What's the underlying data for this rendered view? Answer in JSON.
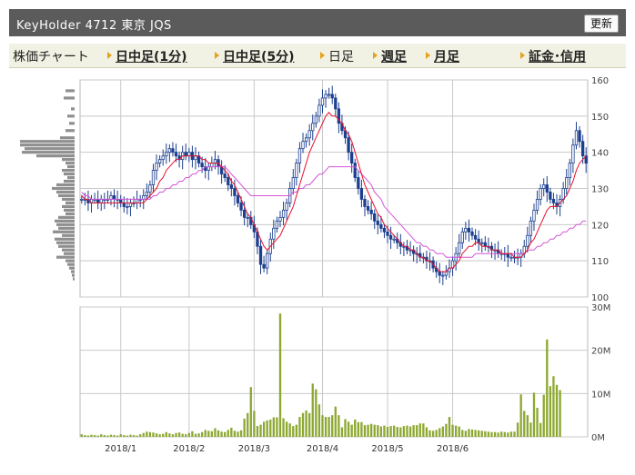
{
  "header": {
    "title": "KeyHolder 4712 東京 JQS",
    "refresh_label": "更新"
  },
  "tabs": [
    {
      "label": "株価チャート",
      "link": false,
      "arrow": false
    },
    {
      "label": "日中足(1分)",
      "link": true,
      "arrow": true
    },
    {
      "label": "日中足(5分)",
      "link": true,
      "arrow": true
    },
    {
      "label": "日足",
      "link": false,
      "arrow": true
    },
    {
      "label": "週足",
      "link": true,
      "arrow": true
    },
    {
      "label": "月足",
      "link": true,
      "arrow": true
    },
    {
      "label": "証金･信用",
      "link": true,
      "arrow": true
    }
  ],
  "colors": {
    "candle": "#1c3f8f",
    "ma_short": "#e8102a",
    "ma_long": "#d455d8",
    "volume": "#8da832",
    "grid": "#c8c8c8",
    "profile": "#8f8f8f"
  },
  "chart_data": [
    {
      "type": "candlestick",
      "title": "",
      "y_ticks": [
        100,
        110,
        120,
        130,
        140,
        150,
        160
      ],
      "ylim": [
        100,
        160
      ],
      "x_labels": [
        "2018/1",
        "2018/2",
        "2018/3",
        "2018/4",
        "2018/5",
        "2018/6"
      ],
      "x_label_day_index": [
        12,
        33,
        53,
        74,
        94,
        114
      ],
      "close_series": [
        127,
        127,
        126,
        127,
        127,
        126,
        127,
        127,
        127,
        128,
        127,
        127,
        126,
        125,
        125,
        126,
        126,
        127,
        127,
        128,
        129,
        131,
        135,
        137,
        138,
        139,
        140,
        141,
        140,
        139,
        138,
        140,
        139,
        140,
        138,
        139,
        137,
        136,
        135,
        136,
        137,
        138,
        136,
        134,
        133,
        131,
        130,
        128,
        126,
        124,
        122,
        122,
        120,
        118,
        114,
        109,
        108,
        112,
        116,
        119,
        121,
        122,
        124,
        126,
        130,
        133,
        137,
        141,
        143,
        144,
        146,
        148,
        150,
        153,
        155,
        156,
        156,
        155,
        152,
        148,
        146,
        144,
        140,
        137,
        133,
        130,
        127,
        125,
        124,
        123,
        121,
        120,
        119,
        118,
        117,
        116,
        116,
        115,
        114,
        114,
        113,
        113,
        112,
        112,
        111,
        111,
        110,
        110,
        108,
        107,
        106,
        106,
        107,
        108,
        110,
        112,
        115,
        118,
        119,
        118,
        117,
        116,
        115,
        115,
        114,
        114,
        113,
        113,
        112,
        112,
        112,
        111,
        111,
        111,
        111,
        112,
        114,
        117,
        121,
        124,
        127,
        130,
        131,
        129,
        127,
        126,
        125,
        127,
        130,
        133,
        137,
        142,
        146,
        143,
        139,
        137
      ],
      "ma_short": [
        128,
        127,
        127,
        126,
        126,
        126,
        126,
        126,
        126,
        126,
        126,
        126,
        126,
        126,
        126,
        126,
        126,
        126,
        126,
        126,
        127,
        128,
        129,
        130,
        132,
        133,
        135,
        136,
        137,
        138,
        138,
        139,
        139,
        139,
        139,
        139,
        139,
        138,
        138,
        137,
        137,
        137,
        137,
        136,
        135,
        134,
        132,
        131,
        129,
        127,
        125,
        123,
        122,
        120,
        118,
        116,
        114,
        113,
        114,
        115,
        116,
        117,
        119,
        121,
        123,
        125,
        128,
        131,
        134,
        137,
        140,
        142,
        144,
        146,
        148,
        150,
        151,
        150,
        150,
        149,
        148,
        146,
        145,
        143,
        140,
        137,
        134,
        131,
        129,
        127,
        125,
        123,
        122,
        120,
        119,
        118,
        117,
        116,
        115,
        114,
        114,
        113,
        113,
        112,
        111,
        111,
        110,
        110,
        109,
        108,
        107,
        107,
        107,
        108,
        108,
        109,
        110,
        112,
        113,
        114,
        114,
        115,
        115,
        114,
        114,
        114,
        113,
        113,
        113,
        112,
        112,
        112,
        112,
        111,
        111,
        111,
        112,
        113,
        115,
        116,
        118,
        120,
        122,
        124,
        125,
        125,
        125,
        126,
        127,
        128,
        130,
        132,
        135,
        137,
        138,
        139
      ],
      "ma_long": [
        129,
        128,
        128,
        127,
        127,
        127,
        127,
        127,
        127,
        127,
        127,
        127,
        127,
        127,
        127,
        127,
        127,
        127,
        127,
        127,
        127,
        127,
        128,
        128,
        129,
        129,
        130,
        130,
        131,
        131,
        132,
        132,
        133,
        133,
        134,
        134,
        135,
        135,
        136,
        136,
        136,
        136,
        136,
        136,
        136,
        135,
        134,
        133,
        132,
        131,
        130,
        129,
        128,
        128,
        128,
        128,
        128,
        128,
        128,
        128,
        128,
        128,
        128,
        128,
        128,
        129,
        129,
        130,
        130,
        131,
        131,
        132,
        133,
        134,
        134,
        135,
        136,
        136,
        136,
        136,
        136,
        136,
        136,
        136,
        136,
        135,
        134,
        133,
        132,
        131,
        129,
        128,
        127,
        125,
        124,
        123,
        122,
        121,
        120,
        119,
        118,
        117,
        116,
        115,
        115,
        114,
        114,
        113,
        113,
        112,
        112,
        112,
        111,
        111,
        111,
        111,
        111,
        111,
        111,
        111,
        111,
        112,
        112,
        112,
        112,
        112,
        112,
        112,
        112,
        112,
        112,
        112,
        112,
        112,
        112,
        112,
        112,
        113,
        113,
        113,
        114,
        114,
        115,
        115,
        116,
        116,
        117,
        117,
        118,
        118,
        119,
        119,
        120,
        120,
        121,
        121
      ],
      "price_profile_levels": [
        157,
        155,
        152,
        150,
        148,
        146,
        144,
        143,
        142,
        141,
        140,
        139,
        138,
        137,
        136,
        135,
        134,
        133,
        132,
        131,
        130,
        129,
        128,
        127,
        126,
        125,
        124,
        123,
        122,
        121,
        120,
        119,
        118,
        117,
        116,
        115,
        114,
        113,
        112,
        111,
        110,
        109,
        108,
        107,
        106,
        105
      ],
      "price_profile_widths": [
        10,
        12,
        4,
        8,
        6,
        10,
        16,
        60,
        60,
        55,
        58,
        42,
        14,
        10,
        8,
        14,
        12,
        8,
        12,
        20,
        25,
        20,
        18,
        14,
        10,
        14,
        12,
        10,
        18,
        22,
        20,
        18,
        24,
        14,
        22,
        20,
        18,
        14,
        12,
        20,
        10,
        8,
        6,
        4,
        3,
        2
      ]
    },
    {
      "type": "bar",
      "title": "",
      "y_ticks": [
        "0M",
        "10M",
        "20M",
        "30M"
      ],
      "ylim": [
        0,
        30
      ],
      "unit": "M",
      "values": [
        0.6,
        0.4,
        0.3,
        0.5,
        0.4,
        0.3,
        0.6,
        0.4,
        0.3,
        0.5,
        0.4,
        0.3,
        0.6,
        0.4,
        0.3,
        0.5,
        0.4,
        0.3,
        0.6,
        0.9,
        1.2,
        1.1,
        1.0,
        0.8,
        0.6,
        0.7,
        1.1,
        0.8,
        0.6,
        0.9,
        1.0,
        0.7,
        0.6,
        0.9,
        1.3,
        0.7,
        0.8,
        1.1,
        1.6,
        1.4,
        1.3,
        2.0,
        1.5,
        1.2,
        1.1,
        1.6,
        2.1,
        1.4,
        1.2,
        1.5,
        4.2,
        5.5,
        11.5,
        6.0,
        2.5,
        2.8,
        3.5,
        3.8,
        4.0,
        4.5,
        4.5,
        28.5,
        4.3,
        3.5,
        3.1,
        2.5,
        2.8,
        4.6,
        5.5,
        6.1,
        5.5,
        12.3,
        11.0,
        7.5,
        5.0,
        4.6,
        4.6,
        5.0,
        7.0,
        5.0,
        2.2,
        4.1,
        3.5,
        2.8,
        4.0,
        3.4,
        3.4,
        2.7,
        2.8,
        3.0,
        2.8,
        2.7,
        2.4,
        2.6,
        2.3,
        2.5,
        2.6,
        2.3,
        2.2,
        2.5,
        2.6,
        2.4,
        2.7,
        2.7,
        3.1,
        3.1,
        2.2,
        1.5,
        1.4,
        1.6,
        2.0,
        2.4,
        3.0,
        4.6,
        2.8,
        2.6,
        2.4,
        1.6,
        1.4,
        1.8,
        1.7,
        1.6,
        1.5,
        1.4,
        1.3,
        1.2,
        1.1,
        1.1,
        1.0,
        1.2,
        1.1,
        1.0,
        1.2,
        1.2,
        3.3,
        9.8,
        6.0,
        5.0,
        3.3,
        10.2,
        6.7,
        3.2,
        9.7,
        22.5,
        11.7,
        14.0,
        12.0,
        10.8
      ]
    }
  ]
}
